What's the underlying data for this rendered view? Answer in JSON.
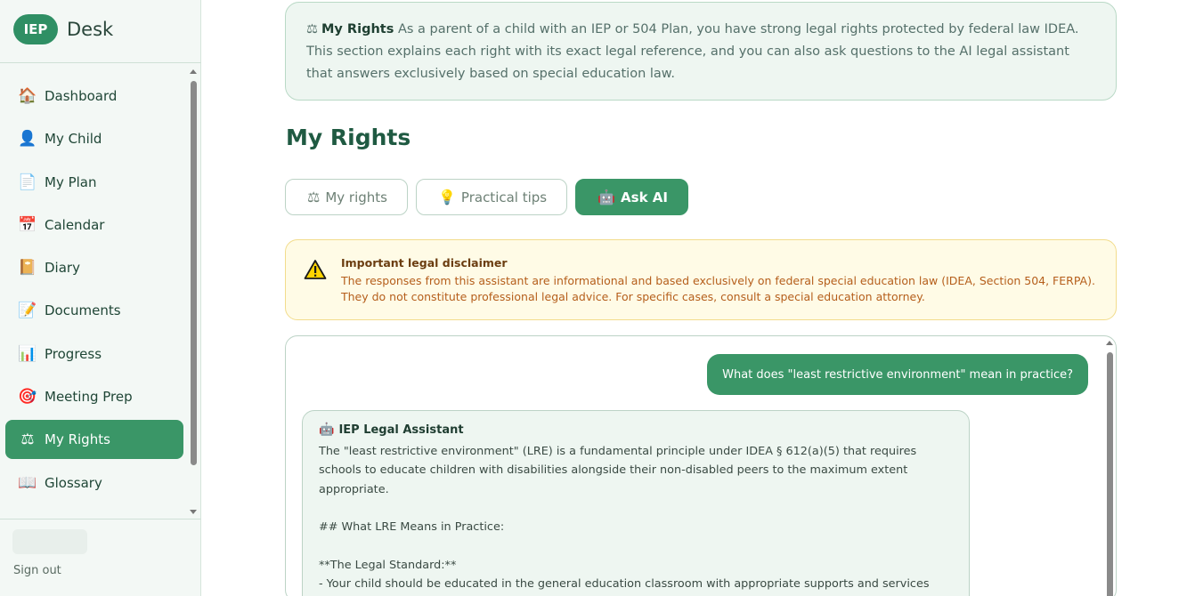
{
  "brand": {
    "badge": "IEP",
    "name": "Desk"
  },
  "nav": {
    "items": [
      {
        "label": "Dashboard",
        "icon": "🏠"
      },
      {
        "label": "My Child",
        "icon": "👤"
      },
      {
        "label": "My Plan",
        "icon": "📄"
      },
      {
        "label": "Calendar",
        "icon": "📅"
      },
      {
        "label": "Diary",
        "icon": "📔"
      },
      {
        "label": "Documents",
        "icon": "📝"
      },
      {
        "label": "Progress",
        "icon": "📊"
      },
      {
        "label": "Meeting Prep",
        "icon": "🎯"
      },
      {
        "label": "My Rights",
        "icon": "⚖"
      },
      {
        "label": "Glossary",
        "icon": "📖"
      }
    ],
    "active": "My Rights",
    "sign_out": "Sign out"
  },
  "info": {
    "icon": "⚖",
    "title": "My Rights",
    "text": "As a parent of a child with an IEP or 504 Plan, you have strong legal rights protected by federal law IDEA. This section explains each right with its exact legal reference, and you can also ask questions to the AI legal assistant that answers exclusively based on special education law."
  },
  "page_title": "My Rights",
  "tabs": [
    {
      "label": "My rights",
      "icon": "⚖"
    },
    {
      "label": "Practical tips",
      "icon": "💡"
    },
    {
      "label": "Ask AI",
      "icon": "🤖"
    }
  ],
  "disclaimer": {
    "title": "Important legal disclaimer",
    "body": "The responses from this assistant are informational and based exclusively on federal special education law (IDEA, Section 504, FERPA). They do not constitute professional legal advice. For specific cases, consult a special education attorney."
  },
  "chat": {
    "user_message": "What does \"least restrictive environment\" mean in practice?",
    "assistant_name": "IEP Legal Assistant",
    "assistant_lines": [
      "The \"least restrictive environment\" (LRE) is a fundamental principle under IDEA § 612(a)(5) that requires schools to educate children with disabilities alongside their non-disabled peers to the maximum extent appropriate.",
      "",
      "## What LRE Means in Practice:",
      "",
      "**The Legal Standard:**",
      "- Your child should be educated in the general education classroom with appropriate supports and services whenever possible"
    ]
  }
}
